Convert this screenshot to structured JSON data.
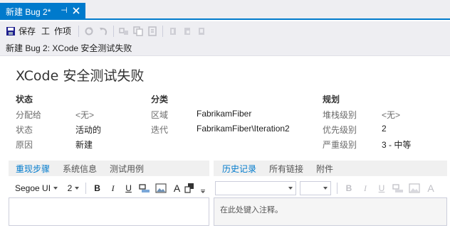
{
  "tab": {
    "title": "新建 Bug 2*",
    "pin_glyph": "⊣"
  },
  "toolbar": {
    "save_label": "保存",
    "tools_glyph": "工",
    "tools_label": "作项"
  },
  "form_title": "新建 Bug 2: XCode 安全测试失败",
  "work_item": {
    "title": "XCode 安全测试失败",
    "status_section": {
      "heading": "状态",
      "assigned_to": {
        "label": "分配给",
        "value": "<无>"
      },
      "state": {
        "label": "状态",
        "value": "活动的"
      },
      "reason": {
        "label": "原因",
        "value": "新建"
      }
    },
    "classification_section": {
      "heading": "分类",
      "area": {
        "label": "区域",
        "value": "FabrikamFiber"
      },
      "iteration": {
        "label": "迭代",
        "value": "FabrikamFiber\\Iteration2"
      }
    },
    "planning_section": {
      "heading": "规划",
      "stack_rank": {
        "label": "堆栈级别",
        "value": "<无>"
      },
      "priority": {
        "label": "优先级别",
        "value": "2"
      },
      "severity": {
        "label": "严重级别",
        "value": "3 - 中等"
      }
    }
  },
  "left_pane": {
    "tabs": [
      "重现步骤",
      "系统信息",
      "测试用例"
    ],
    "font_name": "Segoe UI",
    "font_size": "2"
  },
  "right_pane": {
    "tabs": [
      "历史记录",
      "所有链接",
      "附件"
    ],
    "placeholder": "在此处键入注释。"
  },
  "format": {
    "bold": "B",
    "italic": "I",
    "underline": "U",
    "text_a": "A"
  },
  "colors": {
    "accent": "#007acc",
    "chrome": "#eeeef2"
  }
}
